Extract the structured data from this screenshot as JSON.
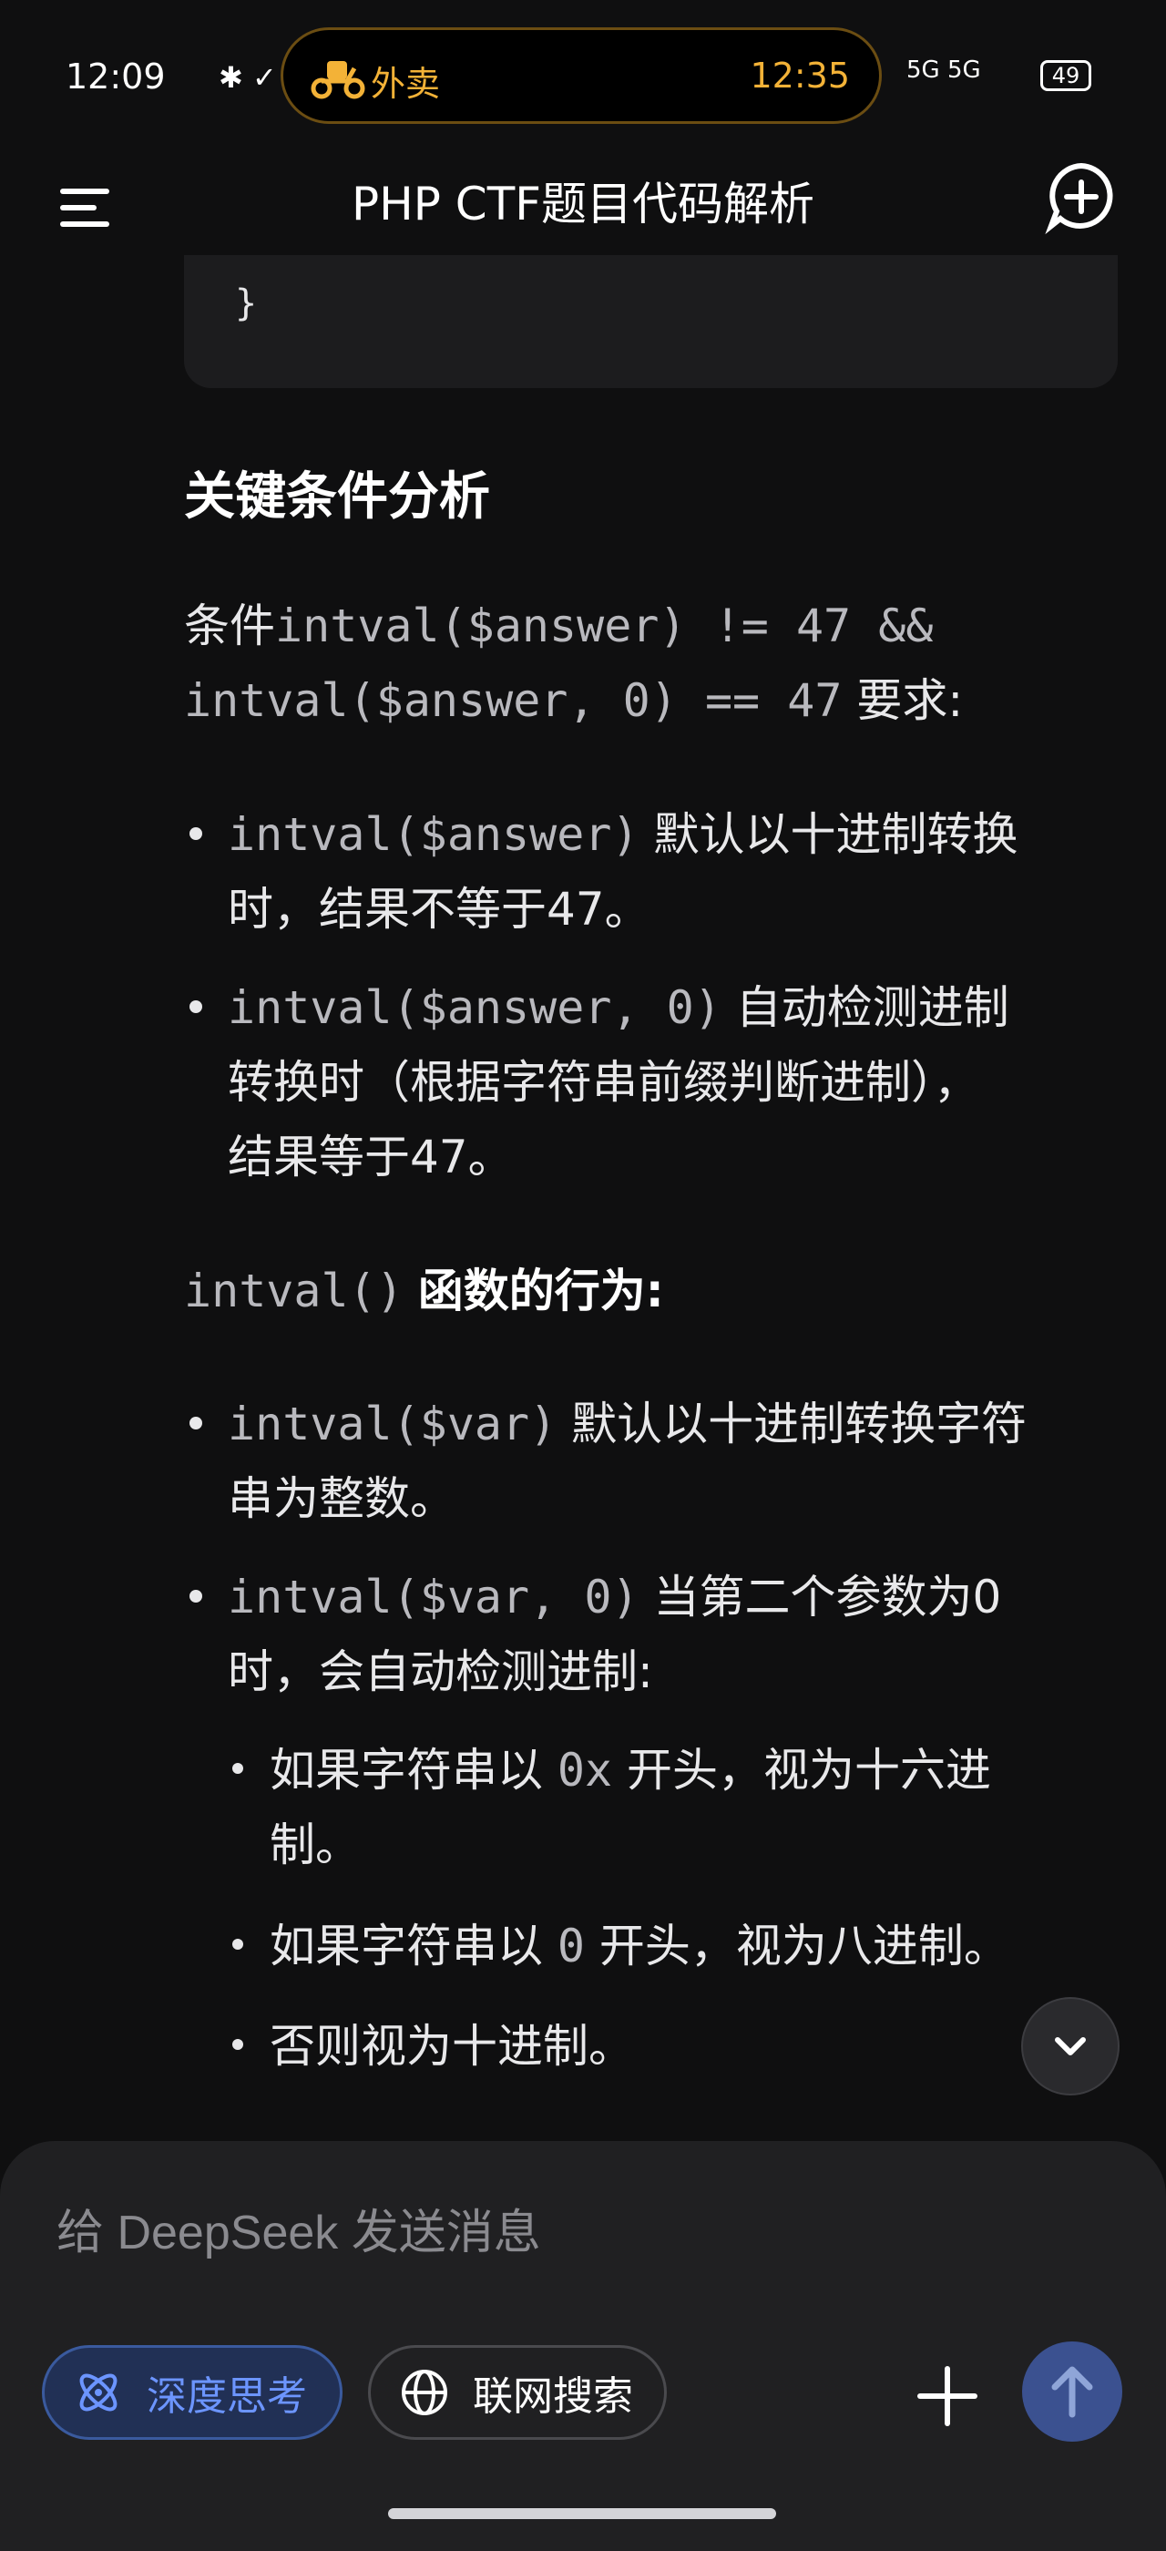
{
  "status_bar": {
    "time": "12:09",
    "left_icons": "✱ ✓",
    "island_label": "外卖",
    "island_time": "12:35",
    "signal_text": "5G 5G",
    "battery": "49"
  },
  "header": {
    "title": "PHP CTF题目代码解析",
    "menu_icon": "menu-icon",
    "new_chat_icon": "new-chat-icon"
  },
  "content": {
    "code_tail": "}",
    "section_heading": "关键条件分析",
    "cond_prefix": "条件",
    "cond_code_1": "intval($answer) != 47 &&",
    "cond_code_2": "intval($answer, 0) == 47",
    "cond_suffix": "要求:",
    "bullets_1": [
      {
        "code": "intval($answer)",
        "text_1": "默认以十进制转换",
        "text_2": "时，结果不等于47。"
      },
      {
        "code": "intval($answer, 0)",
        "text_1": "自动检测进制",
        "text_2": "转换时（根据字符串前缀判断进制），",
        "text_3": "结果等于47。"
      }
    ],
    "func_code": "intval()",
    "func_heading": "函数的行为:",
    "bullets_2": [
      {
        "code": "intval($var)",
        "text_1": "默认以十进制转换字符",
        "text_2": "串为整数。"
      },
      {
        "code": "intval($var, 0)",
        "text_1": "当第二个参数为0",
        "text_2": "时，会自动检测进制:"
      }
    ],
    "sub_bullets": [
      {
        "pre": "如果字符串以",
        "code": "0x",
        "post": "开头，视为十六进",
        "post_2": "制。"
      },
      {
        "pre": "如果字符串以",
        "code": "0",
        "post": "开头，视为八进制。"
      },
      {
        "pre": "否则视为十进制。"
      }
    ]
  },
  "composer": {
    "placeholder": "给 DeepSeek 发送消息",
    "deep_think_label": "深度思考",
    "web_search_label": "联网搜索",
    "deep_think_active": true,
    "accent_color": "#6c95ff"
  }
}
